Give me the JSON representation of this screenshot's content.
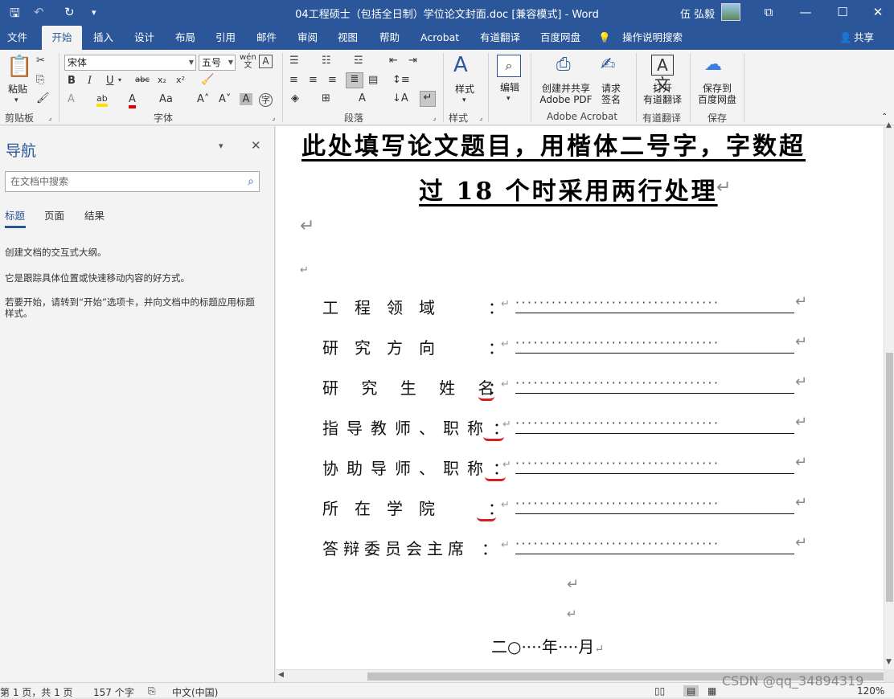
{
  "titlebar": {
    "title": "04工程硕士（包括全日制）学位论文封面.doc [兼容模式]  -  Word",
    "user": "伍 弘毅",
    "save_icon": "save-icon",
    "undo_icon": "undo-icon",
    "redo_icon": "redo-icon"
  },
  "tabs": [
    "文件",
    "开始",
    "插入",
    "设计",
    "布局",
    "引用",
    "邮件",
    "审阅",
    "视图",
    "帮助",
    "Acrobat",
    "有道翻译",
    "百度网盘",
    "操作说明搜索"
  ],
  "share_label": "共享",
  "ribbon": {
    "paste_label": "粘贴",
    "clipboard_label": "剪贴板",
    "font_name": "宋体",
    "font_size": "五号",
    "font_group_label": "字体",
    "paragraph_group_label": "段落",
    "styles_label": "样式",
    "styles_group_label": "样式",
    "edit_label": "编辑",
    "pdf_label_1": "创建并共享",
    "pdf_label_2": "Adobe PDF",
    "sign_label_1": "请求",
    "sign_label_2": "签名",
    "acrobat_group_label": "Adobe Acrobat",
    "youdao_label_1": "打开",
    "youdao_label_2": "有道翻译",
    "youdao_group_label": "有道翻译",
    "baidu_label_1": "保存到",
    "baidu_label_2": "百度网盘",
    "save_group_label": "保存",
    "wen_label": "wén\n文"
  },
  "nav": {
    "title": "导航",
    "search_placeholder": "在文档中搜索",
    "tabs": [
      "标题",
      "页面",
      "结果"
    ],
    "text1": "创建文档的交互式大纲。",
    "text2": "它是跟踪具体位置或快速移动内容的好方式。",
    "text3": "若要开始，请转到“开始”选项卡，并向文档中的标题应用标题样式。"
  },
  "document": {
    "heading_line1": "此处填写论文题目，用楷体二号字，字数超",
    "heading_line2": "过 18 个时采用两行处理",
    "fields": [
      {
        "label": "工　程　领　域",
        "colon": "："
      },
      {
        "label": "研　究　方　向",
        "colon": "："
      },
      {
        "label": "研 究 生 姓 名",
        "colon": "："
      },
      {
        "label": "指导教师、职称",
        "colon": "："
      },
      {
        "label": "协助导师、职称",
        "colon": "："
      },
      {
        "label": "所　在　学　院",
        "colon": "："
      },
      {
        "label": "答辩委员会主席",
        "colon": "："
      }
    ],
    "date_line": "二○····年····月"
  },
  "status": {
    "page": "第 1 页，共 1 页",
    "words": "157 个字",
    "language": "中文(中国)",
    "zoom": "120%"
  },
  "watermark": "CSDN @qq_34894319"
}
